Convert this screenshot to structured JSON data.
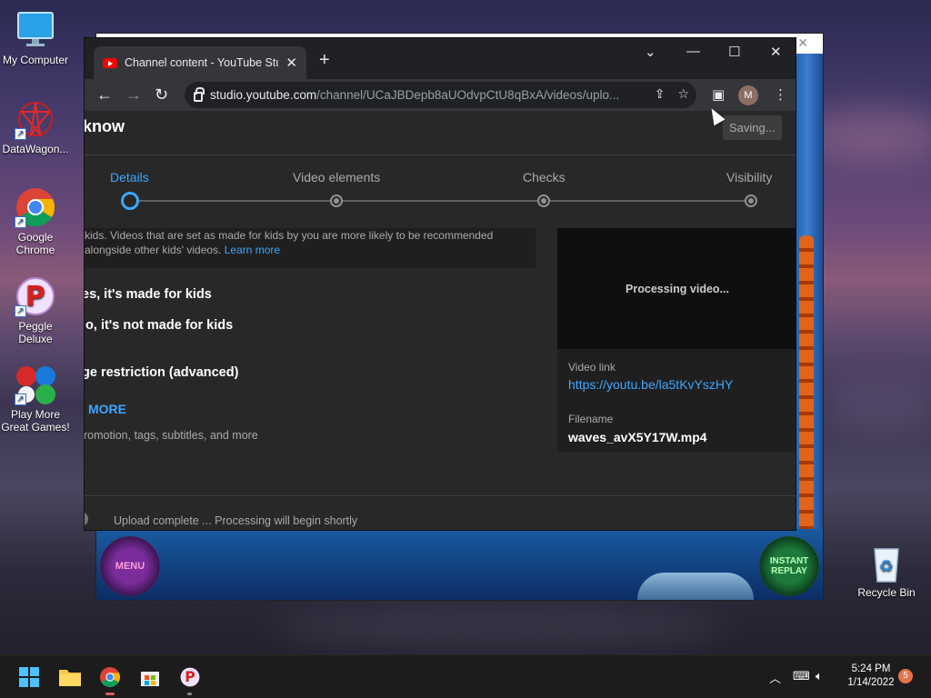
{
  "desktop": {
    "icons": [
      {
        "label": "My Computer"
      },
      {
        "label": "DataWagon..."
      },
      {
        "label": "Google Chrome"
      },
      {
        "label": "Peggle Deluxe"
      },
      {
        "label": "Play More Great Games!"
      },
      {
        "label": "Recycle Bin"
      }
    ]
  },
  "game": {
    "menu_label": "MENU",
    "replay_label": "INSTANT REPLAY"
  },
  "browser": {
    "tab_title": "Channel content - YouTube Studio",
    "url_host": "studio.youtube.com",
    "url_path": "/channel/UCaJBDepb8aUOdvpCtU8qBxA/videos/uplo...",
    "profile_initial": "M"
  },
  "studio": {
    "title": "know",
    "saving_label": "Saving...",
    "steps": [
      {
        "label": "Details"
      },
      {
        "label": "Video elements"
      },
      {
        "label": "Checks"
      },
      {
        "label": "Visibility"
      }
    ],
    "kids_text": "kids. Videos that are set as made for kids by you are more likely to be recommended alongside other kids' videos.",
    "learn_more": "Learn more",
    "option_yes": "es, it's made for kids",
    "option_no": "lo, it's not made for kids",
    "age_restriction": "ge restriction (advanced)",
    "show_more": "MORE",
    "show_more_sub": "romotion, tags, subtitles, and more",
    "processing": "Processing video...",
    "video_link_label": "Video link",
    "video_link": "https://youtu.be/la5tKvYszHY",
    "filename_label": "Filename",
    "filename": "waves_avX5Y17W.mp4",
    "footer_status": "Upload complete ... Processing will begin shortly"
  },
  "taskbar": {
    "time": "5:24 PM",
    "date": "1/14/2022",
    "notification_count": "5"
  }
}
